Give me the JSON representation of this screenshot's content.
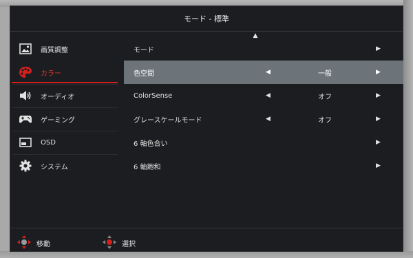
{
  "osd": {
    "title": "モード - 標準",
    "sidebar": [
      {
        "label": "画質調整",
        "icon": "picture-icon",
        "active": false
      },
      {
        "label": "カラー",
        "icon": "palette-icon",
        "active": true
      },
      {
        "label": "オーディオ",
        "icon": "speaker-icon",
        "active": false
      },
      {
        "label": "ゲーミング",
        "icon": "gamepad-icon",
        "active": false
      },
      {
        "label": "OSD",
        "icon": "osd-window-icon",
        "active": false
      },
      {
        "label": "システム",
        "icon": "gear-icon",
        "active": false
      }
    ],
    "rows": [
      {
        "label": "モード",
        "value": "",
        "selected": false
      },
      {
        "label": "色空間",
        "value": "一般",
        "selected": true
      },
      {
        "label": "ColorSense",
        "value": "オフ",
        "selected": false
      },
      {
        "label": "グレースケールモード",
        "value": "オフ",
        "selected": false
      },
      {
        "label": "6 軸色合い",
        "value": "",
        "selected": false
      },
      {
        "label": "6 軸飽和",
        "value": "",
        "selected": false
      }
    ],
    "footer": {
      "move_label": "移動",
      "select_label": "選択"
    },
    "colors": {
      "accent": "#d3201d",
      "selected_row": "#6d7479",
      "panel": "#1b1d20"
    }
  }
}
